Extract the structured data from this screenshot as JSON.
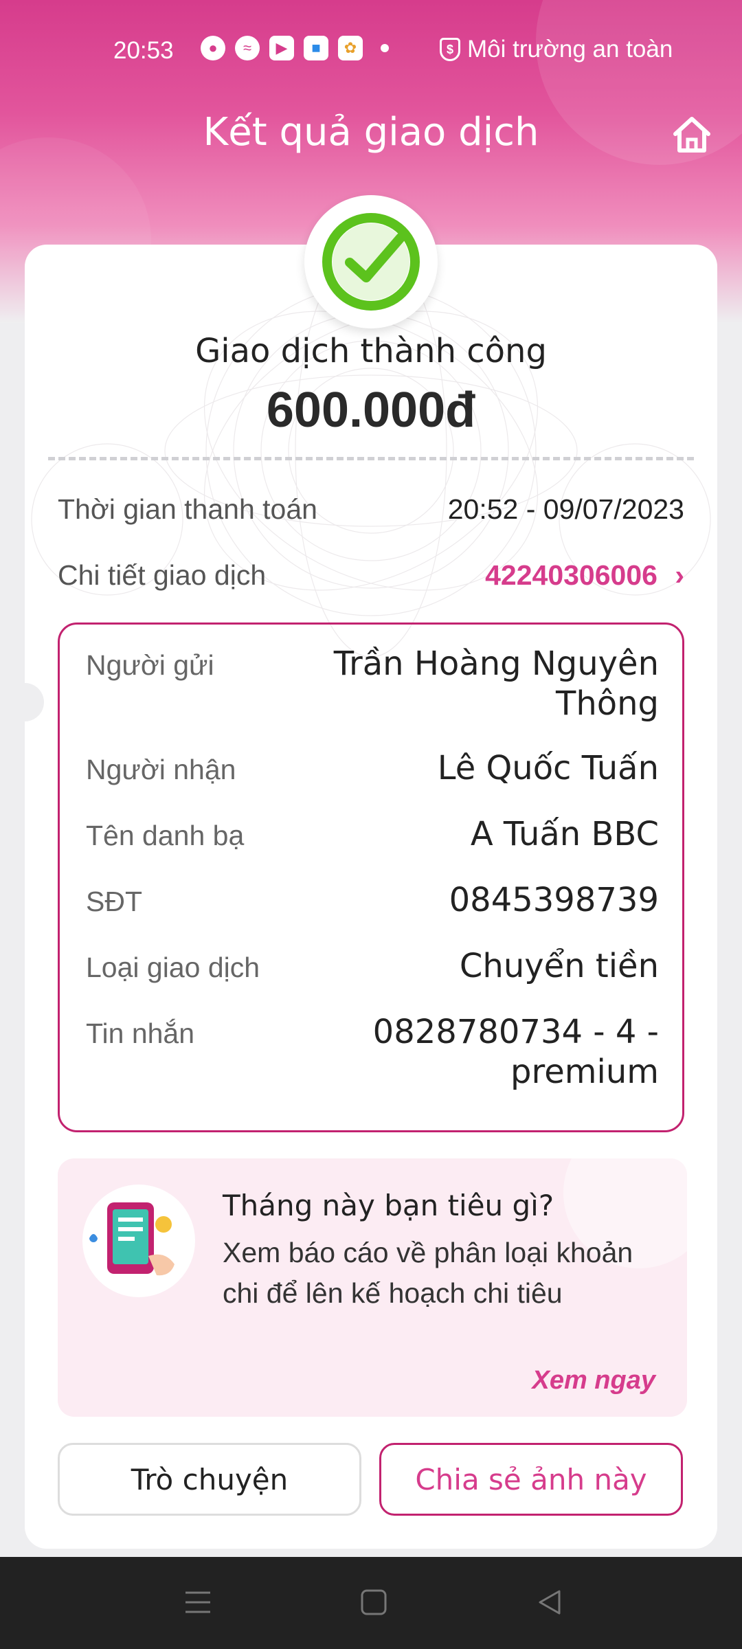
{
  "status_bar": {
    "time": "20:53",
    "safe_label": "Môi trường an toàn",
    "icons": [
      "bubble-icon",
      "messenger-icon",
      "play-icon",
      "files-icon",
      "photos-icon"
    ]
  },
  "header": {
    "title": "Kết quả giao dịch"
  },
  "result": {
    "status": "Giao dịch thành công",
    "amount": "600.000đ"
  },
  "summary": {
    "time_label": "Thời gian thanh toán",
    "time_value": "20:52 - 09/07/2023",
    "detail_label": "Chi tiết giao dịch",
    "detail_value": "42240306006"
  },
  "details": [
    {
      "label": "Người gửi",
      "value": "Trần Hoàng Nguyên Thông"
    },
    {
      "label": "Người nhận",
      "value": "Lê Quốc Tuấn"
    },
    {
      "label": "Tên danh bạ",
      "value": "A Tuấn BBC"
    },
    {
      "label": "SĐT",
      "value": "0845398739"
    },
    {
      "label": "Loại giao dịch",
      "value": "Chuyển tiền"
    },
    {
      "label": "Tin nhắn",
      "value": "0828780734 - 4 - premium"
    }
  ],
  "promo": {
    "title": "Tháng này bạn tiêu gì?",
    "description": "Xem báo cáo về phân loại khoản chi để lên kế hoạch chi tiêu",
    "link": "Xem ngay"
  },
  "actions": {
    "chat": "Trò chuyện",
    "share": "Chia sẻ ảnh này"
  },
  "colors": {
    "accent": "#d63c8c",
    "success": "#5cc21d"
  }
}
